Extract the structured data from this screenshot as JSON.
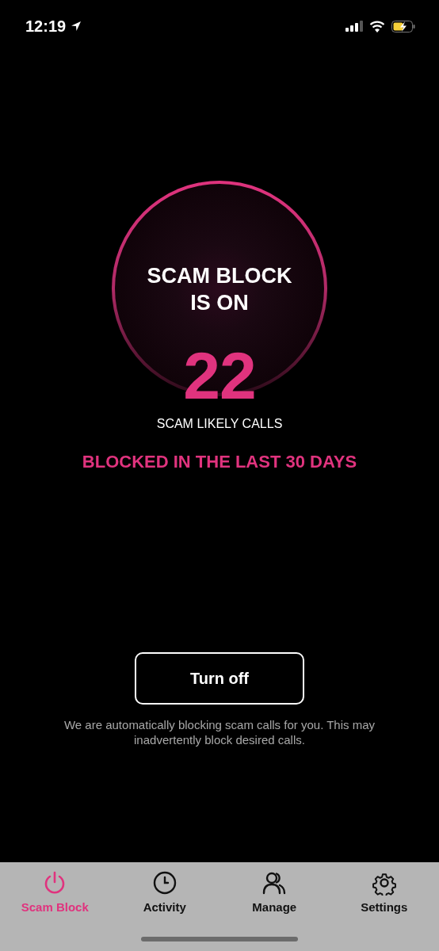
{
  "status_bar": {
    "time": "12:19"
  },
  "status": {
    "title": "SCAM BLOCK\nIS ON",
    "count": "22",
    "caption": "SCAM LIKELY CALLS",
    "period": "BLOCKED IN THE LAST 30 DAYS"
  },
  "action_button": "Turn off",
  "note": "We are automatically blocking scam calls for you. This may inadvertently block desired calls.",
  "tabs": [
    {
      "label": "Scam Block",
      "selected": true
    },
    {
      "label": "Activity",
      "selected": false
    },
    {
      "label": "Manage",
      "selected": false
    },
    {
      "label": "Settings",
      "selected": false
    }
  ]
}
